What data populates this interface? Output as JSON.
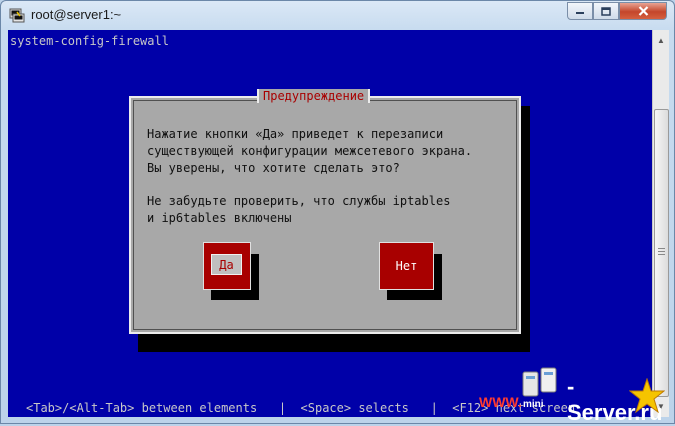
{
  "window": {
    "title": "root@server1:~",
    "buttons": {
      "minimize": "minimize",
      "maximize": "maximize",
      "close": "close"
    }
  },
  "terminal": {
    "app_title": "system-config-firewall",
    "status_line": "<Tab>/<Alt-Tab> between elements   |  <Space> selects   |  <F12> next screen"
  },
  "dialog": {
    "title": "Предупреждение",
    "lines": [
      "Нажатие кнопки «Да» приведет к перезаписи",
      "существующей конфигурации межсетевого экрана.",
      "Вы уверены, что хотите сделать это?",
      "",
      "Не забудьте проверить, что службы iptables",
      "и ip6tables включены"
    ],
    "yes_label": "Да",
    "no_label": "Нет"
  },
  "watermark": {
    "brand": "-Server.ru",
    "www": "WWW.",
    "mini": "mini"
  },
  "colors": {
    "terminal_bg": "#0000a8",
    "dialog_bg": "#a8a8a8",
    "button_red": "#a80000",
    "title_red": "#a80000"
  }
}
